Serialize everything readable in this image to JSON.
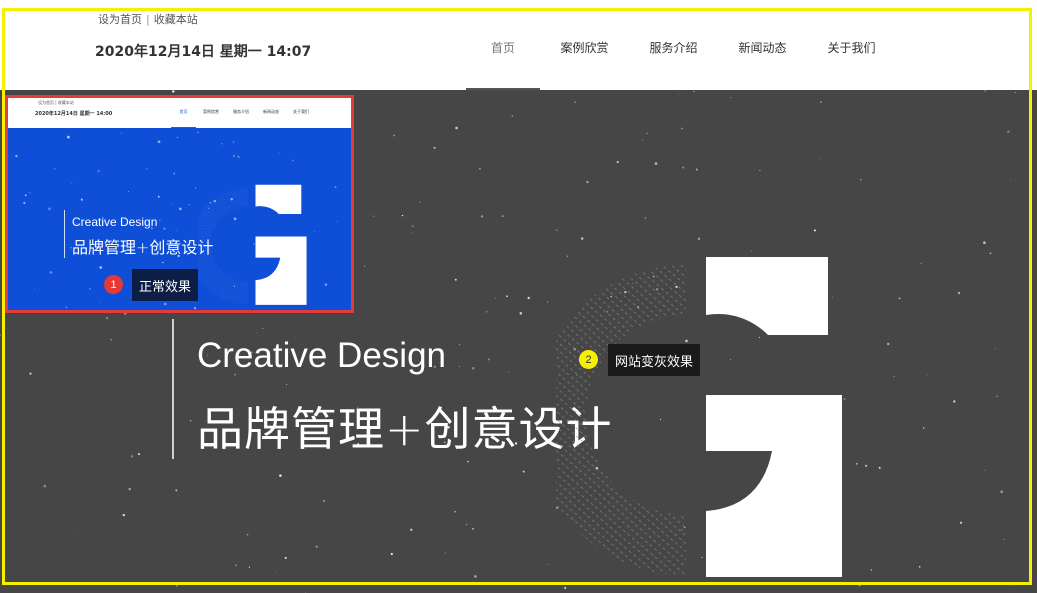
{
  "header": {
    "top_links": {
      "set_home": "设为首页",
      "separator": "|",
      "bookmark": "收藏本站"
    },
    "datetime": "2020年12月14日 星期一 14:07",
    "nav": [
      "首页",
      "案例欣赏",
      "服务介绍",
      "新闻动态",
      "关于我们"
    ]
  },
  "banner": {
    "title_en": "Creative Design",
    "title_cn": "品牌管理+创意设计"
  },
  "thumbnail": {
    "top_links": "设为首页 | 收藏本站",
    "datetime": "2020年12月14日 星期一 14:00",
    "nav": [
      "首页",
      "案例欣赏",
      "服务介绍",
      "新闻动态",
      "关于我们"
    ],
    "title_en": "Creative Design",
    "title_cn": "品牌管理+创意设计"
  },
  "annotations": [
    {
      "number": "1",
      "text": "正常效果"
    },
    {
      "number": "2",
      "text": "网站变灰效果"
    }
  ],
  "colors": {
    "gray_banner": "#464646",
    "blue_banner": "#0f4fd8",
    "frame_yellow": "#f5f000",
    "frame_red": "#e23b3b"
  },
  "icons": [
    "g-logo-icon"
  ]
}
